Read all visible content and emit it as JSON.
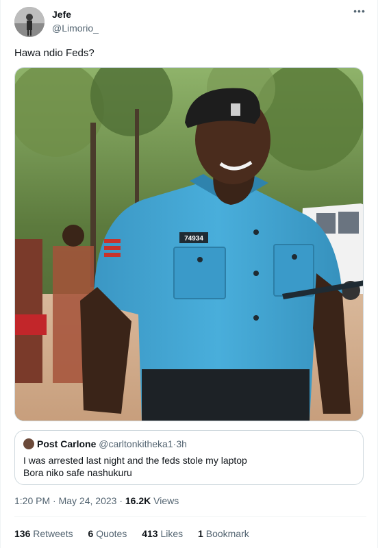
{
  "author": {
    "display_name": "Jefe",
    "handle": "@Limorio_"
  },
  "icons": {
    "more": "more-horizontal-icon",
    "quote_avatar": "avatar"
  },
  "tweet": {
    "text": "Hawa ndio Feds?"
  },
  "photo": {
    "badge_number": "74934"
  },
  "quoted_tweet": {
    "author_name": "Post Carlone",
    "author_handle": "@carltonkitheka1",
    "separator": "·",
    "time_ago": "3h",
    "line1": "I was arrested last night and the feds stole my laptop",
    "line2": "Bora niko safe nashukuru"
  },
  "meta": {
    "time": "1:20 PM",
    "dot1": "·",
    "date": "May 24, 2023",
    "dot2": "·",
    "views_count": "16.2K",
    "views_label": "Views"
  },
  "stats": {
    "retweets_count": "136",
    "retweets_label": "Retweets",
    "quotes_count": "6",
    "quotes_label": "Quotes",
    "likes_count": "413",
    "likes_label": "Likes",
    "bookmarks_count": "1",
    "bookmarks_label": "Bookmark"
  },
  "colors": {
    "text_primary": "#0f1419",
    "text_secondary": "#536471",
    "border": "#cfd9de",
    "divider": "#eff3f4",
    "uniform_blue": "#3fa3d1"
  }
}
